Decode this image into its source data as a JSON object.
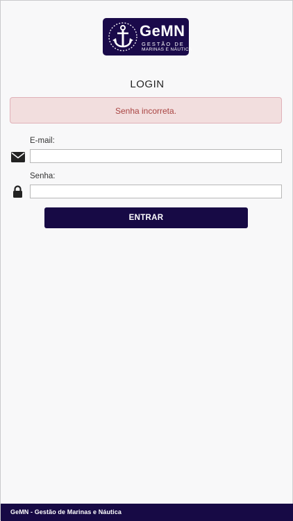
{
  "brand": {
    "name": "GeMN",
    "subtitle_line1": "GESTÃO DE",
    "subtitle_line2": "MARINAS E NÁUTICA",
    "logo_icon": "anchor-icon",
    "color": "#1a0a4a"
  },
  "login": {
    "title": "LOGIN",
    "error_message": "Senha incorreta.",
    "email_label": "E-mail:",
    "email_value": "",
    "email_icon": "envelope-icon",
    "password_label": "Senha:",
    "password_value": "",
    "password_icon": "lock-icon",
    "submit_label": "ENTRAR"
  },
  "footer": {
    "text": "GeMN - Gestão de Marinas e Náutica"
  },
  "colors": {
    "primary": "#170a45",
    "alert_background": "#f2dede",
    "alert_text": "#a94442",
    "page_background": "#f8f8f9"
  }
}
